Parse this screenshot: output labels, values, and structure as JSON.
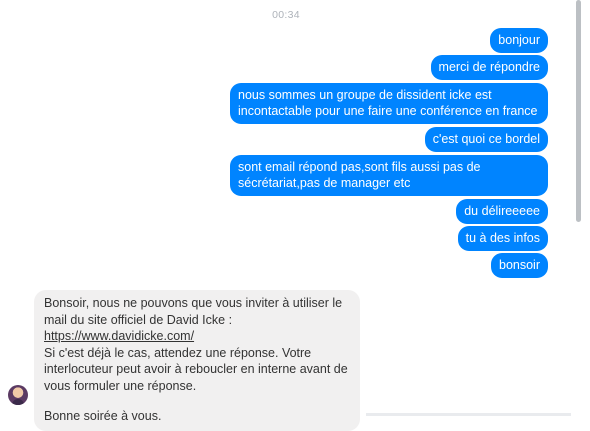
{
  "timestamp": "00:34",
  "outgoing_messages": [
    "bonjour",
    "merci de répondre",
    "nous sommes un groupe de dissident icke est incontactable pour une faire une conférence en france",
    "c'est quoi ce bordel",
    "sont email répond pas,sont fils aussi pas de sécrétariat,pas de manager etc",
    "du délireeeee",
    "tu à des infos",
    "bonsoir"
  ],
  "incoming_message": {
    "line1": "Bonsoir, nous ne pouvons que vous inviter à utiliser le mail du site officiel de David Icke : ",
    "link": "https://www.davidicke.com/",
    "line2": "Si c'est déjà le cas, attendez une réponse. Votre interlocuteur peut avoir à reboucler en interne avant de vous formuler une réponse.",
    "closing": "Bonne soirée à vous."
  },
  "colors": {
    "outgoing_bubble": "#0084ff",
    "incoming_bubble": "#f1f0f0",
    "timestamp": "#aeb3ba"
  }
}
